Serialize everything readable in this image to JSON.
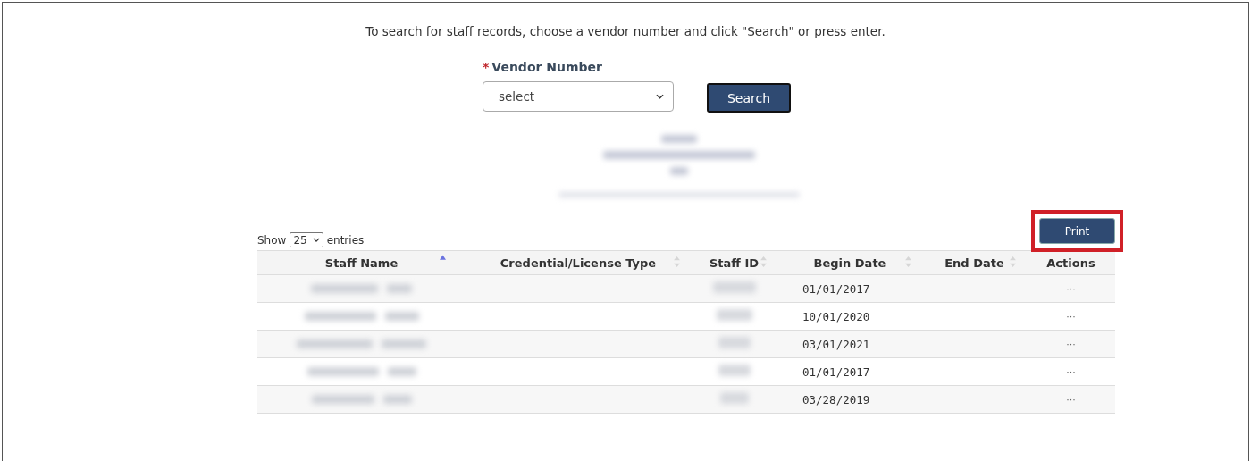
{
  "instructions": "To search for staff records, choose a vendor number and click \"Search\" or press enter.",
  "vendor_field": {
    "required_mark": "*",
    "label": "Vendor Number",
    "value": "select"
  },
  "search_button": "Search",
  "print_button": {
    "label": "Print",
    "highlighted": true
  },
  "length_menu": {
    "before": "Show",
    "value": "25",
    "after": "entries"
  },
  "table": {
    "columns": [
      {
        "label": "Staff Name",
        "sortable": true,
        "sorted_ascending": true
      },
      {
        "label": "Credential/License Type",
        "sortable": true,
        "sorted_ascending": false
      },
      {
        "label": "Staff ID",
        "sortable": true,
        "sorted_ascending": false
      },
      {
        "label": "Begin Date",
        "sortable": true,
        "sorted_ascending": false
      },
      {
        "label": "End Date",
        "sortable": true,
        "sorted_ascending": false
      },
      {
        "label": "Actions"
      }
    ],
    "rows": [
      {
        "begin_date": "01/01/2017",
        "actions": "···"
      },
      {
        "begin_date": "10/01/2020",
        "actions": "···"
      },
      {
        "begin_date": "03/01/2021",
        "actions": "···"
      },
      {
        "begin_date": "01/01/2017",
        "actions": "···"
      },
      {
        "begin_date": "03/28/2019",
        "actions": "···"
      }
    ]
  }
}
